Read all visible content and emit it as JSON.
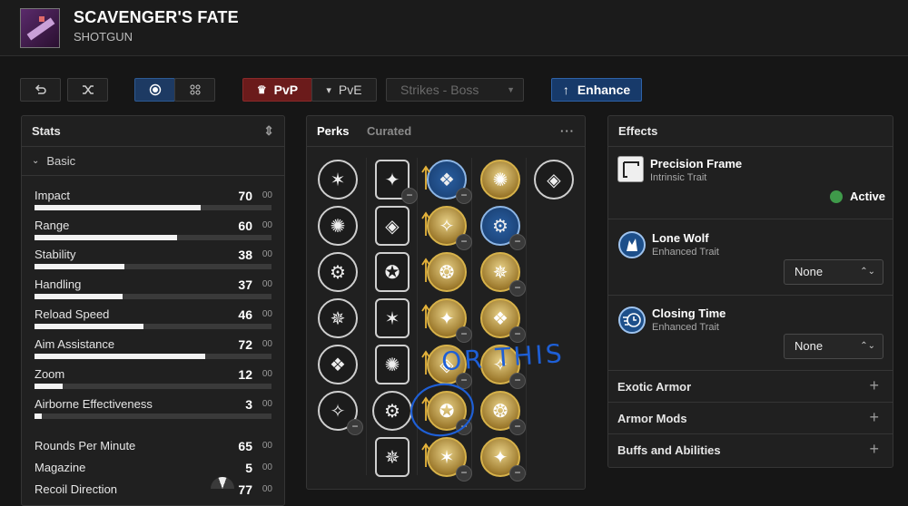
{
  "weapon": {
    "name": "SCAVENGER'S FATE",
    "type": "SHOTGUN"
  },
  "toolbar": {
    "pvp_label": "PvP",
    "pve_label": "PvE",
    "activity_select": "Strikes - Boss",
    "enhance_label": "Enhance"
  },
  "stats": {
    "title": "Stats",
    "section": "Basic",
    "items": [
      {
        "name": "Impact",
        "value": "70",
        "suffix": "00",
        "fill": 0.7
      },
      {
        "name": "Range",
        "value": "60",
        "suffix": "00",
        "fill": 0.6
      },
      {
        "name": "Stability",
        "value": "38",
        "suffix": "00",
        "fill": 0.38
      },
      {
        "name": "Handling",
        "value": "37",
        "suffix": "00",
        "fill": 0.37
      },
      {
        "name": "Reload Speed",
        "value": "46",
        "suffix": "00",
        "fill": 0.46
      },
      {
        "name": "Aim Assistance",
        "value": "72",
        "suffix": "00",
        "fill": 0.72
      },
      {
        "name": "Zoom",
        "value": "12",
        "suffix": "00",
        "fill": 0.12
      },
      {
        "name": "Airborne Effectiveness",
        "value": "3",
        "suffix": "00",
        "fill": 0.03
      },
      {
        "name": "Rounds Per Minute",
        "value": "65",
        "suffix": "00"
      },
      {
        "name": "Magazine",
        "value": "5",
        "suffix": "00"
      },
      {
        "name": "Recoil Direction",
        "value": "77",
        "suffix": "00"
      }
    ]
  },
  "perks": {
    "tab_perks": "Perks",
    "tab_curated": "Curated",
    "annotation": "OR THIS"
  },
  "effects": {
    "title": "Effects",
    "intrinsic": {
      "name": "Precision Frame",
      "sub": "Intrinsic Trait",
      "status": "Active"
    },
    "trait1": {
      "name": "Lone Wolf",
      "sub": "Enhanced Trait",
      "select": "None"
    },
    "trait2": {
      "name": "Closing Time",
      "sub": "Enhanced Trait",
      "select": "None"
    },
    "sections": [
      "Exotic Armor",
      "Armor Mods",
      "Buffs and Abilities"
    ]
  },
  "colors": {
    "active_dot": "#3f9a4a",
    "gold": "#d7b24a",
    "enhance": "#173a6a",
    "pvp": "#6b1b1b",
    "annotation": "#1e5fd6"
  }
}
